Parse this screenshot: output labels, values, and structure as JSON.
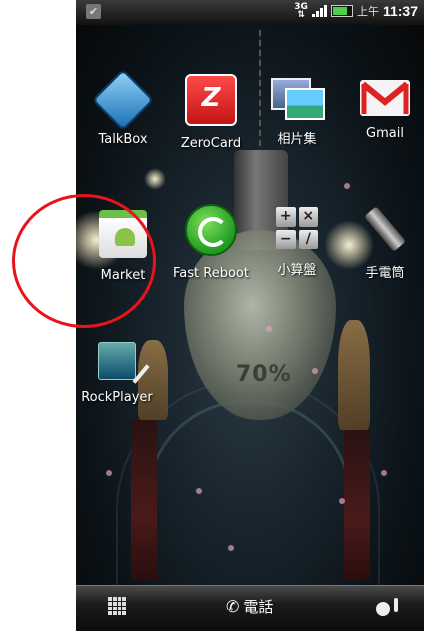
{
  "status_bar": {
    "network": "3G",
    "ampm": "上午",
    "time": "11:37",
    "icons": [
      "notification-check-icon",
      "network-3g-icon",
      "signal-icon",
      "battery-icon"
    ]
  },
  "wallpaper": {
    "bulb_percent": "70%"
  },
  "apps": [
    {
      "label": "TalkBox",
      "icon": "talkbox-icon"
    },
    {
      "label": "ZeroCard",
      "icon": "zerocard-icon"
    },
    {
      "label": "相片集",
      "icon": "gallery-icon"
    },
    {
      "label": "Gmail",
      "icon": "gmail-icon"
    },
    {
      "label": "Market",
      "icon": "market-icon"
    },
    {
      "label": "Fast Reboot",
      "icon": "fast-reboot-icon"
    },
    {
      "label": "小算盤",
      "icon": "calculator-icon"
    },
    {
      "label": "手電筒",
      "icon": "flashlight-icon"
    },
    {
      "label": "RockPlayer",
      "icon": "rockplayer-icon"
    }
  ],
  "dock": {
    "phone_label": "電話",
    "icons": [
      "all-apps-icon",
      "phone-icon",
      "personalize-icon"
    ]
  },
  "annotation": {
    "color": "#e8141a"
  }
}
